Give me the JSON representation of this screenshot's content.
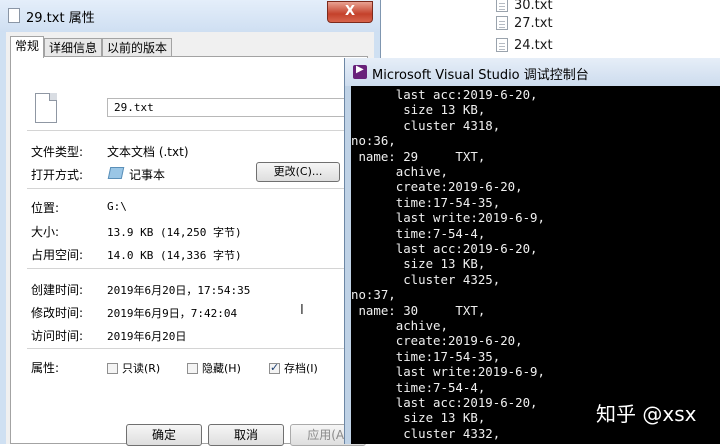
{
  "explorer": {
    "files": [
      "30.txt",
      "27.txt",
      "24.txt"
    ]
  },
  "dialog": {
    "title": "29.txt 属性",
    "close_label": "X",
    "tabs": [
      "常规",
      "详细信息",
      "以前的版本"
    ],
    "file_name": "29.txt",
    "fields": {
      "type_label": "文件类型:",
      "type_value": "文本文档 (.txt)",
      "open_label": "打开方式:",
      "open_value": "记事本",
      "change_button": "更改(C)...",
      "location_label": "位置:",
      "location_value": "G:\\",
      "size_label": "大小:",
      "size_value": "13.9 KB (14,250 字节)",
      "disk_label": "占用空间:",
      "disk_value": "14.0 KB (14,336 字节)",
      "created_label": "创建时间:",
      "created_value": "2019年6月20日，17:54:35",
      "modified_label": "修改时间:",
      "modified_value": "2019年6月9日，7:42:04",
      "accessed_label": "访问时间:",
      "accessed_value": "2019年6月20日",
      "attr_label": "属性:"
    },
    "attributes": [
      {
        "label": "只读(R)",
        "checked": false
      },
      {
        "label": "隐藏(H)",
        "checked": false
      },
      {
        "label": "存档(I)",
        "checked": true
      }
    ],
    "buttons": {
      "ok": "确定",
      "cancel": "取消",
      "apply": "应用(A)"
    }
  },
  "console": {
    "title": "Microsoft Visual Studio 调试控制台",
    "lines": [
      "      last acc:2019-6-20,",
      "       size 13 KB,",
      "       cluster 4318,",
      "no:36,",
      " name: 29     TXT,",
      "      achive,",
      "      create:2019-6-20,",
      "      time:17-54-35,",
      "      last write:2019-6-9,",
      "      time:7-54-4,",
      "      last acc:2019-6-20,",
      "       size 13 KB,",
      "       cluster 4325,",
      "no:37,",
      " name: 30     TXT,",
      "      achive,",
      "      create:2019-6-20,",
      "      time:17-54-35,",
      "      last write:2019-6-9,",
      "      time:7-54-4,",
      "      last acc:2019-6-20,",
      "       size 13 KB,",
      "       cluster 4332,"
    ]
  },
  "watermark": "知乎 @xsx"
}
